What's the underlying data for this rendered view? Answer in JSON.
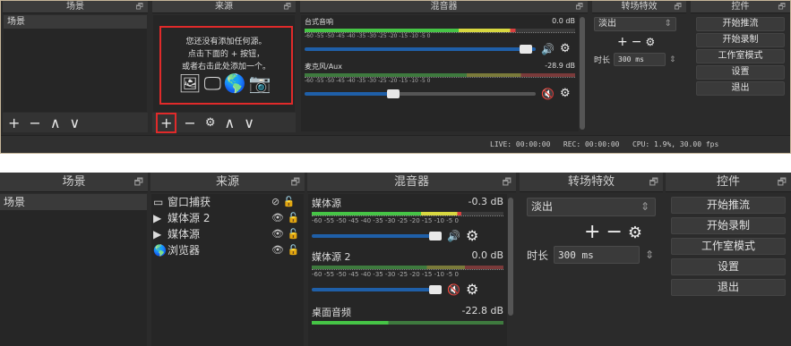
{
  "top": {
    "headers": {
      "scenes": "场景",
      "sources": "来源",
      "mixer": "混音器",
      "transitions": "转场特效",
      "controls": "控件"
    },
    "scenes": [
      "场景"
    ],
    "empty_msg": [
      "您还没有添加任何源。",
      "点击下面的 + 按钮，",
      "或者右击此处添加一个。"
    ],
    "source_icons": "🖼🖵🌎📷",
    "tracks": [
      {
        "name": "台式音响",
        "db": "0.0 dB",
        "ticks": "-60 -55 -50 -45 -40 -35 -30 -25 -20 -15 -10 -5 0",
        "muted": false,
        "fill": 0.92
      },
      {
        "name": "麦克风/Aux",
        "db": "-28.9 dB",
        "ticks": "-60 -55 -50 -45 -40 -35 -30 -25 -20 -15 -10 -5 0",
        "muted": true,
        "fill": 0.36
      }
    ],
    "transition": {
      "name": "淡出",
      "duration_label": "时长",
      "duration": "300 ms"
    },
    "controls": [
      "开始推流",
      "开始录制",
      "工作室模式",
      "设置",
      "退出"
    ],
    "status": "LIVE: 00:00:00   REC: 00:00:00   CPU: 1.9%, 30.00 fps",
    "toolbar": {
      "add": "+",
      "remove": "−",
      "up": "∧",
      "down": "∨",
      "gear": "⚙"
    }
  },
  "bot": {
    "headers": {
      "scenes": "场景",
      "sources": "来源",
      "mixer": "混音器",
      "transitions": "转场特效",
      "controls": "控件"
    },
    "scenes": [
      "场景"
    ],
    "sources": [
      {
        "icon": "▭",
        "name": "窗口捕获",
        "vis": "⊘",
        "lock": "🔓"
      },
      {
        "icon": "▶",
        "name": "媒体源 2",
        "vis": "👁",
        "lock": "🔓"
      },
      {
        "icon": "▶",
        "name": "媒体源",
        "vis": "👁",
        "lock": "🔓"
      },
      {
        "icon": "🌎",
        "name": "浏览器",
        "vis": "👁",
        "lock": "🔓"
      }
    ],
    "tracks": [
      {
        "name": "媒体源",
        "db": "-0.3 dB",
        "ticks": "-60 -55 -50 -45 -40 -35 -30 -25 -20 -15 -10 -5 0",
        "muted": false,
        "fill": 0.9
      },
      {
        "name": "媒体源 2",
        "db": "0.0 dB",
        "ticks": "-60 -55 -50 -45 -40 -35 -30 -25 -20 -15 -10 -5 0",
        "muted": true,
        "fill": 0.9
      },
      {
        "name": "桌面音频",
        "db": "-22.8 dB",
        "ticks": "",
        "muted": false,
        "fill": 0.4
      }
    ],
    "transition": {
      "name": "淡出",
      "duration_label": "时长",
      "duration": "300 ms"
    },
    "controls": [
      "开始推流",
      "开始录制",
      "工作室模式",
      "设置",
      "退出"
    ],
    "pin": "🗗"
  }
}
